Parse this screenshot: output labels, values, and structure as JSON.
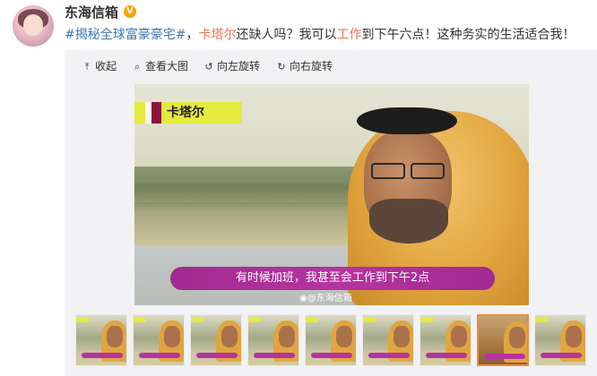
{
  "user": {
    "name": "东海信箱",
    "verified_badge": "V"
  },
  "post": {
    "hashtag": "#揭秘全球富豪豪宅#",
    "segments": [
      {
        "text": "，",
        "style": "plain"
      },
      {
        "text": "卡塔尔",
        "style": "link"
      },
      {
        "text": "还缺人吗？我可以",
        "style": "plain"
      },
      {
        "text": "工作",
        "style": "link"
      },
      {
        "text": "到下午六点！这种务实的生活适合我！",
        "style": "plain"
      }
    ]
  },
  "toolbar": {
    "collapse_label": "收起",
    "view_large_label": "查看大图",
    "rotate_left_label": "向左旋转",
    "rotate_right_label": "向右旋转"
  },
  "image": {
    "channel_tag": "卡塔尔",
    "subtitle": "有时候加班，我甚至会工作到下午2点",
    "watermark": "@东海信箱"
  },
  "thumbnails": {
    "count": 9,
    "active_index": 7
  },
  "colors": {
    "link": "#eb7350",
    "hashtag": "#3c74b8",
    "caption_bg": "#b634a0",
    "tag_bar": "#e5ea3f",
    "active_thumb_border": "#f08a3c"
  },
  "icons": {
    "collapse": "arrow-up-icon",
    "view_large": "magnifier-icon",
    "rotate_left": "rotate-left-icon",
    "rotate_right": "rotate-right-icon",
    "watermark": "weibo-icon"
  }
}
